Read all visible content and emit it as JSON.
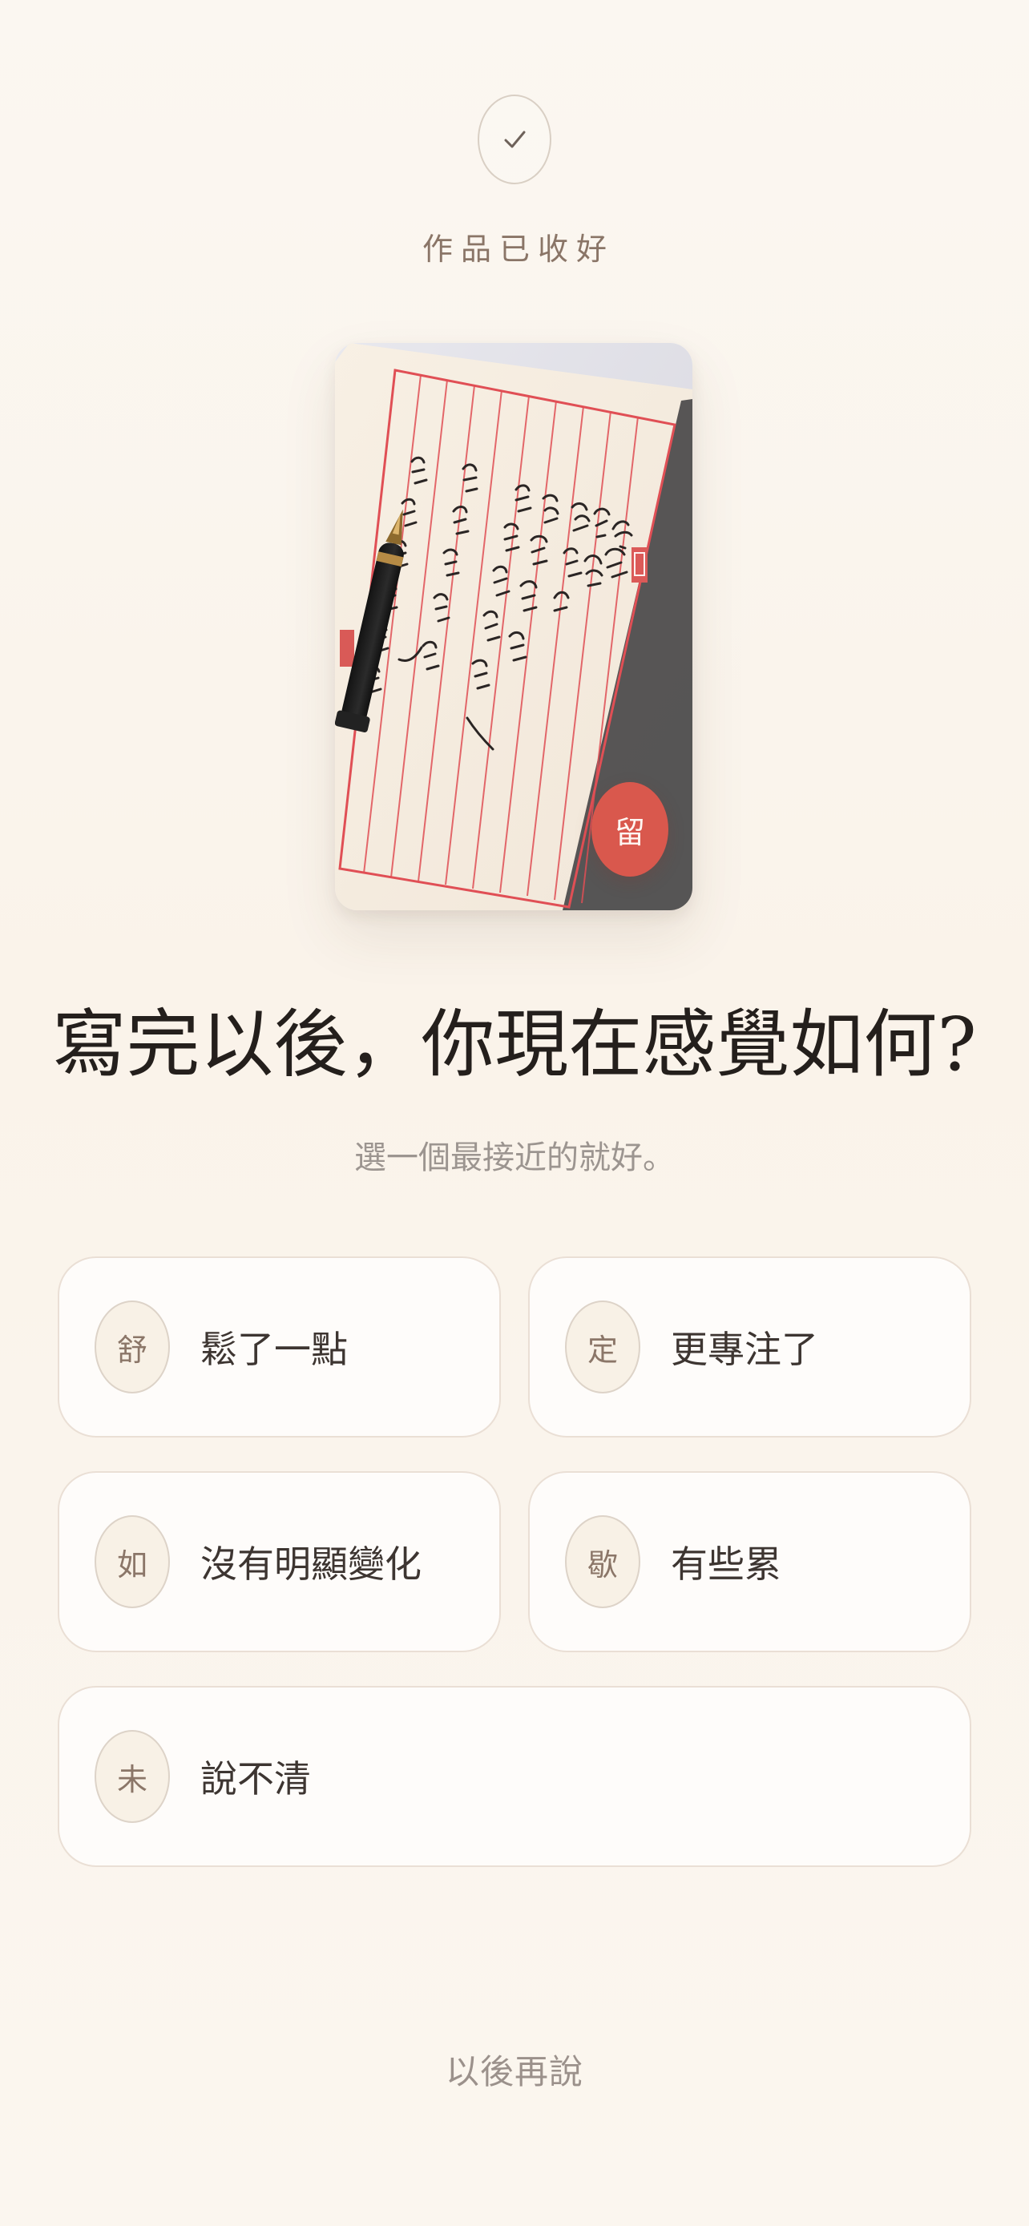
{
  "status": {
    "icon": "check-icon",
    "text": "作品已收好"
  },
  "artwork": {
    "stamp_label": "留",
    "stamp_color": "#d9584d",
    "paper_color": "#f6eee3",
    "grid_color": "#e04f55"
  },
  "question": {
    "title": "寫完以後，你現在感覺如何?",
    "subtitle": "選一個最接近的就好。"
  },
  "options": [
    {
      "badge": "舒",
      "label": "鬆了一點"
    },
    {
      "badge": "定",
      "label": "更專注了"
    },
    {
      "badge": "如",
      "label": "沒有明顯變化"
    },
    {
      "badge": "歇",
      "label": "有些累"
    },
    {
      "badge": "未",
      "label": "說不清"
    }
  ],
  "footer": {
    "later_label": "以後再說"
  }
}
